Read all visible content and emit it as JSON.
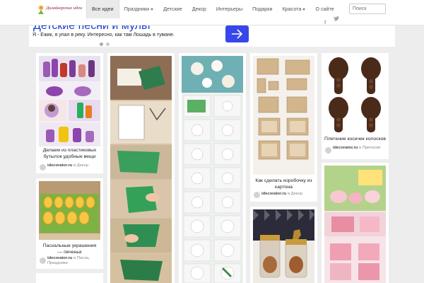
{
  "header": {
    "logo_text": "Дизайнерские идеи",
    "nav": [
      {
        "label": "Все идеи",
        "active": true
      },
      {
        "label": "Праздники",
        "dropdown": true
      },
      {
        "label": "Детские"
      },
      {
        "label": "Декор"
      },
      {
        "label": "Интерьеры"
      },
      {
        "label": "Подарки"
      },
      {
        "label": "Красота",
        "dropdown": true
      },
      {
        "label": "О сайте"
      }
    ],
    "search_placeholder": "Поиск",
    "social": {
      "twitter_icon": "twitter-icon",
      "facebook_label": "f"
    }
  },
  "banner": {
    "title": "Детские песни и мульт",
    "text": "Я - Ежик, я упал в реку. Интересно, как там Лошадь в тумане."
  },
  "pins": [
    {
      "title": "Делаем из пластиковых бутылок удобные вещи",
      "source": "idecorator.ru",
      "board": "Декор",
      "via": "в"
    },
    {
      "title": "Пасхальные украшения — печенья",
      "source": "idecorator.ru",
      "board": "Пасха, Праздники",
      "via": "в"
    },
    {
      "title": "Как сделать коробочку из картона",
      "source": "idecorator.ru",
      "board": "Декор",
      "via": "в"
    },
    {
      "title": "Плетение косичек колосков",
      "source": "idecorator.ru",
      "board": "Прически",
      "via": "в"
    }
  ],
  "colors": {
    "accent": "#3847ea",
    "banner_title": "#1a3bc8",
    "logo": "#8a1a33"
  }
}
